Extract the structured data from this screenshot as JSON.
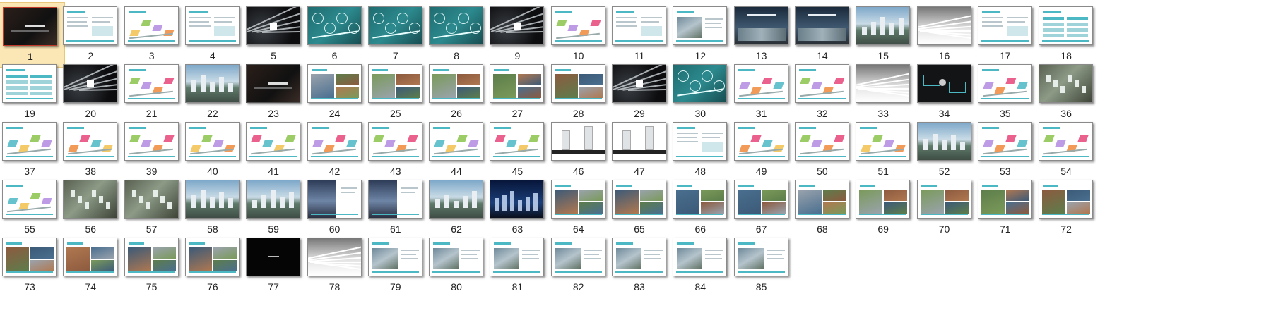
{
  "slides": [
    {
      "n": "1",
      "style": "dark-title",
      "selected": true
    },
    {
      "n": "2",
      "style": "doc"
    },
    {
      "n": "3",
      "style": "diagram"
    },
    {
      "n": "4",
      "style": "doc"
    },
    {
      "n": "5",
      "style": "dark-lines"
    },
    {
      "n": "6",
      "style": "teal-map"
    },
    {
      "n": "7",
      "style": "teal-map"
    },
    {
      "n": "8",
      "style": "teal-map"
    },
    {
      "n": "9",
      "style": "dark-lines"
    },
    {
      "n": "10",
      "style": "diagram"
    },
    {
      "n": "11",
      "style": "doc"
    },
    {
      "n": "12",
      "style": "doc-photo"
    },
    {
      "n": "13",
      "style": "dark-photo"
    },
    {
      "n": "14",
      "style": "dark-photo"
    },
    {
      "n": "15",
      "style": "photo"
    },
    {
      "n": "16",
      "style": "gray-lines"
    },
    {
      "n": "17",
      "style": "doc"
    },
    {
      "n": "18",
      "style": "table"
    },
    {
      "n": "19",
      "style": "table"
    },
    {
      "n": "20",
      "style": "dark-lines"
    },
    {
      "n": "21",
      "style": "diagram"
    },
    {
      "n": "22",
      "style": "photo"
    },
    {
      "n": "23",
      "style": "dark-title"
    },
    {
      "n": "24",
      "style": "photo-split"
    },
    {
      "n": "25",
      "style": "photo-split"
    },
    {
      "n": "26",
      "style": "photo-split"
    },
    {
      "n": "27",
      "style": "photo-split"
    },
    {
      "n": "28",
      "style": "photo-split"
    },
    {
      "n": "29",
      "style": "dark-lines"
    },
    {
      "n": "30",
      "style": "teal-map"
    },
    {
      "n": "31",
      "style": "diagram"
    },
    {
      "n": "32",
      "style": "diagram"
    },
    {
      "n": "33",
      "style": "gray-lines"
    },
    {
      "n": "34",
      "style": "dark-map"
    },
    {
      "n": "35",
      "style": "diagram"
    },
    {
      "n": "36",
      "style": "aerial"
    },
    {
      "n": "37",
      "style": "diagram"
    },
    {
      "n": "38",
      "style": "diagram"
    },
    {
      "n": "39",
      "style": "diagram"
    },
    {
      "n": "40",
      "style": "diagram"
    },
    {
      "n": "41",
      "style": "diagram"
    },
    {
      "n": "42",
      "style": "diagram"
    },
    {
      "n": "43",
      "style": "diagram"
    },
    {
      "n": "44",
      "style": "diagram"
    },
    {
      "n": "45",
      "style": "diagram"
    },
    {
      "n": "46",
      "style": "section"
    },
    {
      "n": "47",
      "style": "section"
    },
    {
      "n": "48",
      "style": "doc"
    },
    {
      "n": "49",
      "style": "diagram"
    },
    {
      "n": "50",
      "style": "diagram"
    },
    {
      "n": "51",
      "style": "diagram"
    },
    {
      "n": "52",
      "style": "photo"
    },
    {
      "n": "53",
      "style": "diagram"
    },
    {
      "n": "54",
      "style": "diagram"
    },
    {
      "n": "55",
      "style": "diagram"
    },
    {
      "n": "56",
      "style": "aerial"
    },
    {
      "n": "57",
      "style": "aerial"
    },
    {
      "n": "58",
      "style": "photo"
    },
    {
      "n": "59",
      "style": "photo"
    },
    {
      "n": "60",
      "style": "photo-half"
    },
    {
      "n": "61",
      "style": "photo-half"
    },
    {
      "n": "62",
      "style": "photo"
    },
    {
      "n": "63",
      "style": "night"
    },
    {
      "n": "64",
      "style": "photo-split"
    },
    {
      "n": "65",
      "style": "photo-split"
    },
    {
      "n": "66",
      "style": "photo-split"
    },
    {
      "n": "67",
      "style": "photo-split"
    },
    {
      "n": "68",
      "style": "photo-split"
    },
    {
      "n": "69",
      "style": "photo-split"
    },
    {
      "n": "70",
      "style": "photo-split"
    },
    {
      "n": "71",
      "style": "photo-split"
    },
    {
      "n": "72",
      "style": "photo-split"
    },
    {
      "n": "73",
      "style": "photo-split"
    },
    {
      "n": "74",
      "style": "photo-split"
    },
    {
      "n": "75",
      "style": "photo-split"
    },
    {
      "n": "76",
      "style": "photo-split"
    },
    {
      "n": "77",
      "style": "black"
    },
    {
      "n": "78",
      "style": "gray-lines"
    },
    {
      "n": "79",
      "style": "doc-photo"
    },
    {
      "n": "80",
      "style": "doc-photo"
    },
    {
      "n": "81",
      "style": "doc-photo"
    },
    {
      "n": "82",
      "style": "doc-photo"
    },
    {
      "n": "83",
      "style": "doc-photo"
    },
    {
      "n": "84",
      "style": "doc-photo"
    },
    {
      "n": "85",
      "style": "doc-photo"
    }
  ],
  "colors": {
    "accent": "#4bb8c4",
    "selection": "#fbe6b5",
    "label": "#222222"
  }
}
